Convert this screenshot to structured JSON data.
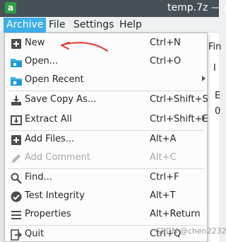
{
  "window": {
    "title": "temp.7z — A",
    "icon_letter": "a"
  },
  "menubar": {
    "items": [
      {
        "label": "Archive",
        "active": true
      },
      {
        "label": "File"
      },
      {
        "label": "Settings"
      },
      {
        "label": "Help"
      }
    ]
  },
  "background": {
    "toolbar_fragment": "Fin",
    "col_fragment": "I",
    "row_text_1": "E",
    "row_text_2": "0"
  },
  "menu": {
    "items": [
      {
        "label": "New",
        "shortcut": "Ctrl+N",
        "icon": "plus-box-icon"
      },
      {
        "label": "Open...",
        "shortcut": "Ctrl+O",
        "icon": "folder-open-icon"
      },
      {
        "label": "Open Recent",
        "shortcut": "",
        "icon": "folder-recent-icon",
        "submenu": true
      },
      {
        "label": "Save Copy As...",
        "shortcut": "Ctrl+Shift+S",
        "icon": "save-copy-icon"
      },
      {
        "label": "Extract All",
        "shortcut": "Ctrl+Shift+E",
        "icon": "extract-icon",
        "submenu": true
      },
      {
        "label": "Add Files...",
        "shortcut": "Alt+A",
        "icon": "add-files-icon"
      },
      {
        "label": "Add Comment",
        "shortcut": "Alt+C",
        "icon": "pencil-icon",
        "disabled": true
      },
      {
        "label": "Find...",
        "shortcut": "Ctrl+F",
        "icon": "search-icon"
      },
      {
        "label": "Test Integrity",
        "shortcut": "Alt+T",
        "icon": "check-circle-icon"
      },
      {
        "label": "Properties",
        "shortcut": "Alt+Return",
        "icon": "properties-icon"
      },
      {
        "label": "Quit",
        "shortcut": "Ctrl+Q",
        "icon": "quit-icon"
      }
    ]
  },
  "watermark": "CSDN @chen2232",
  "colors": {
    "highlight": "#3daee9",
    "annotation_arrow": "#e53935",
    "titlebar": "#475057"
  }
}
